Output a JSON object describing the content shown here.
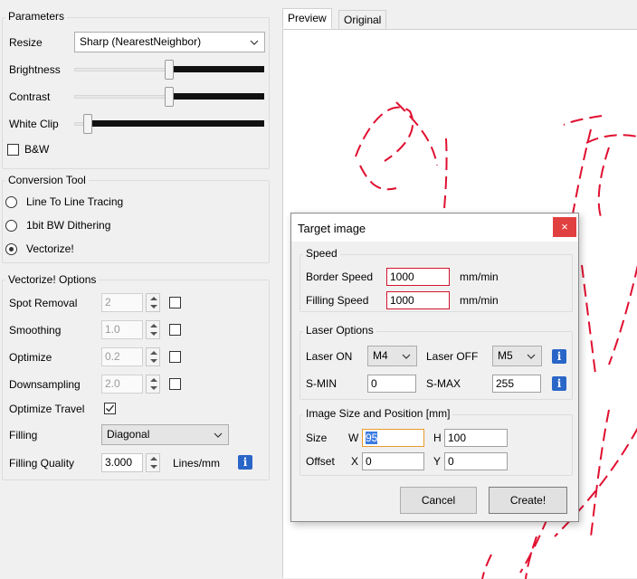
{
  "parameters": {
    "title": "Parameters",
    "resize_label": "Resize",
    "resize_value": "Sharp (NearestNeighbor)",
    "brightness_label": "Brightness",
    "contrast_label": "Contrast",
    "whiteclip_label": "White Clip",
    "bw_label": "B&W",
    "brightness_level": 0.49,
    "contrast_level": 0.49,
    "whiteclip_level": 0.06
  },
  "conversion": {
    "title": "Conversion Tool",
    "options": [
      "Line To Line Tracing",
      "1bit BW Dithering",
      "Vectorize!"
    ],
    "selected": "Vectorize!"
  },
  "vectorize": {
    "title": "Vectorize! Options",
    "spot_removal_label": "Spot Removal",
    "spot_removal_value": "2",
    "smoothing_label": "Smoothing",
    "smoothing_value": "1.0",
    "optimize_label": "Optimize",
    "optimize_value": "0.2",
    "downsampling_label": "Downsampling",
    "downsampling_value": "2.0",
    "optimize_travel_label": "Optimize Travel",
    "filling_label": "Filling",
    "filling_value": "Diagonal",
    "filling_quality_label": "Filling Quality",
    "filling_quality_value": "3.000",
    "filling_quality_unit": "Lines/mm"
  },
  "tabs": [
    "Preview",
    "Original"
  ],
  "dialog": {
    "title": "Target image",
    "close_glyph": "×",
    "speed_title": "Speed",
    "border_speed_label": "Border Speed",
    "border_speed_value": "1000",
    "filling_speed_label": "Filling Speed",
    "filling_speed_value": "1000",
    "speed_unit": "mm/min",
    "laser_title": "Laser Options",
    "laser_on_label": "Laser ON",
    "laser_on_value": "M4",
    "laser_off_label": "Laser OFF",
    "laser_off_value": "M5",
    "smin_label": "S-MIN",
    "smin_value": "0",
    "smax_label": "S-MAX",
    "smax_value": "255",
    "size_title": "Image Size and Position [mm]",
    "size_label": "Size",
    "w_label": "W",
    "w_value": "95",
    "h_label": "H",
    "h_value": "100",
    "offset_label": "Offset",
    "x_label": "X",
    "x_value": "0",
    "y_label": "Y",
    "y_value": "0",
    "cancel_label": "Cancel",
    "create_label": "Create!"
  },
  "icons": {
    "info": "i",
    "checkmark": "✓"
  },
  "colors": {
    "accent_red": "#d2152d",
    "info_blue": "#2a66c8",
    "preview_red": "#e01030"
  }
}
